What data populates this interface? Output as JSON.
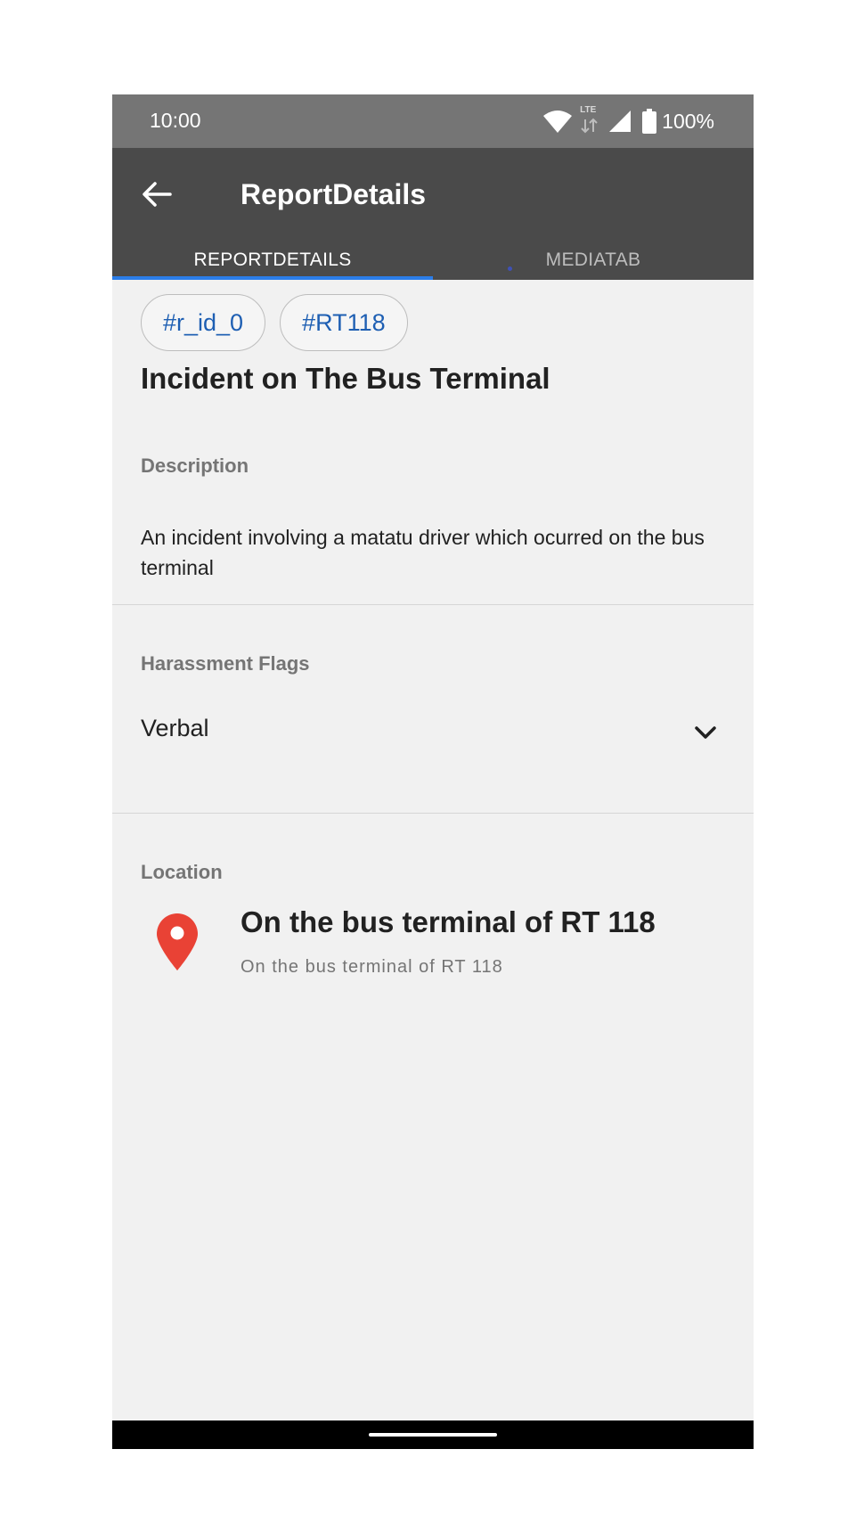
{
  "status_bar": {
    "time": "10:00",
    "network_label": "LTE",
    "battery": "100%",
    "icons": [
      "wifi-icon",
      "lte-icon",
      "cell-signal-icon",
      "battery-icon"
    ]
  },
  "app_bar": {
    "title": "ReportDetails",
    "back_icon": "arrow-back-icon"
  },
  "tabs": [
    {
      "label": "REPORTDETAILS",
      "active": true
    },
    {
      "label": "MEDIATAB",
      "active": false
    }
  ],
  "report": {
    "tags": [
      "#r_id_0",
      "#RT118"
    ],
    "title": "Incident on The Bus Terminal",
    "description_label": "Description",
    "description": "An incident involving a matatu driver which ocurred on the bus terminal",
    "flags_label": "Harassment Flags",
    "flag_selected": "Verbal",
    "location_label": "Location",
    "location_title": "On the bus terminal of RT 118",
    "location_subtitle": "On the bus terminal of RT 118"
  },
  "colors": {
    "status_bar": "#757575",
    "app_bar": "#4a4a4a",
    "tab_indicator": "#2b7de9",
    "chip_text": "#1e5fb3",
    "pin": "#e94235",
    "background": "#f1f1f1"
  }
}
